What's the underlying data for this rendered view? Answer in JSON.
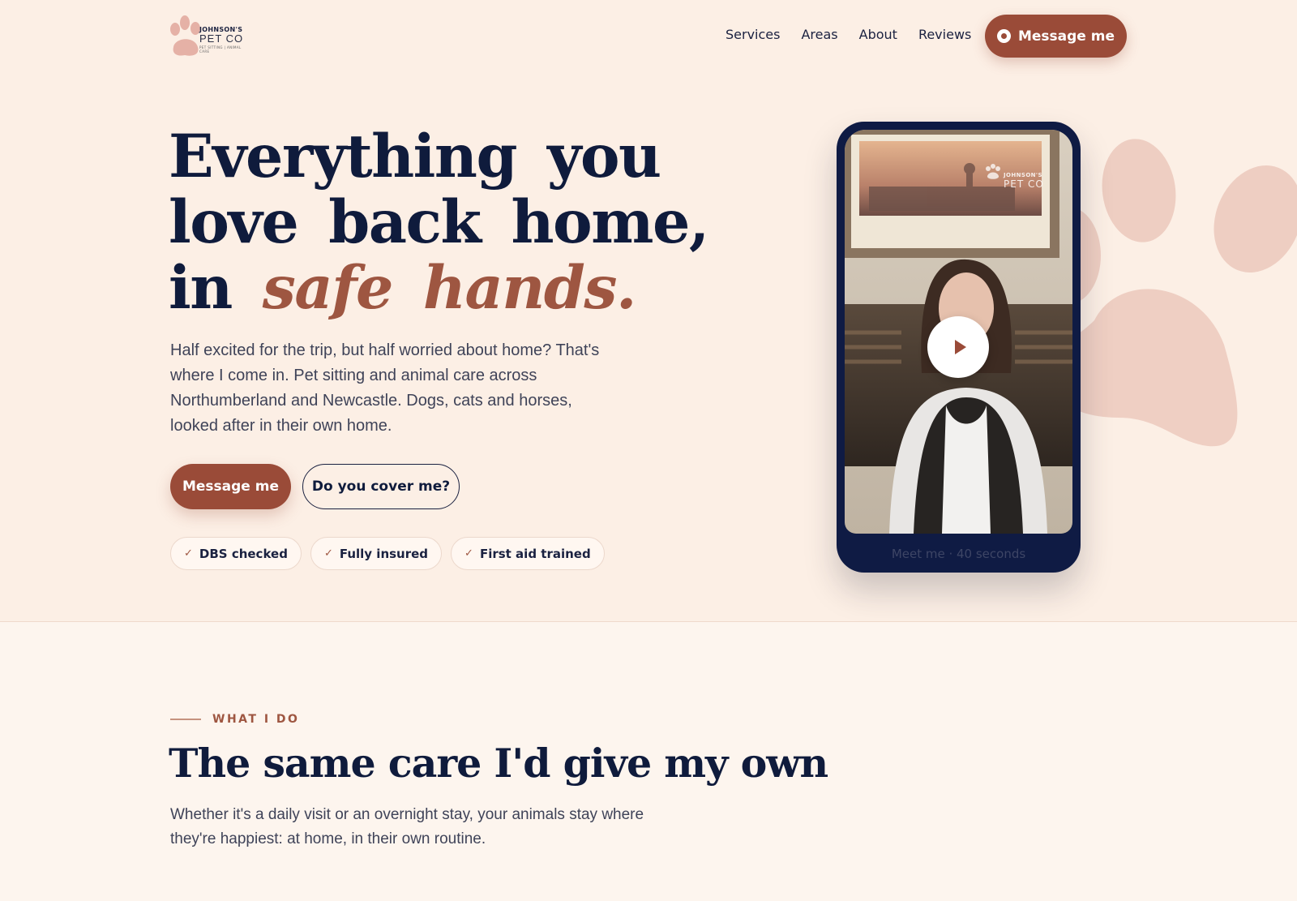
{
  "brand": {
    "logo_line1": "JOHNSON'S",
    "logo_line2": "PET CO",
    "logo_line3": "PET SITTING | ANIMAL CARE"
  },
  "nav": {
    "items": [
      "Services",
      "Areas",
      "About",
      "Reviews"
    ],
    "cta_label": "Message me"
  },
  "hero": {
    "headline_line1": "Everything you",
    "headline_line2": "love back home,",
    "headline_line3_prefix": "in",
    "headline_accent": "safe hands.",
    "lead": "Half excited for the trip, but half worried about home? That's where I come in. Pet sitting and animal care across Northumberland and Newcastle. Dogs, cats and horses, looked after in their own home.",
    "primary_button": "Message me",
    "secondary_button": "Do you cover me?",
    "badges": [
      "DBS checked",
      "Fully insured",
      "First aid trained"
    ]
  },
  "video": {
    "caption": "Meet me · 40 seconds",
    "watermark_line1": "JOHNSON'S",
    "watermark_line2": "PET CO"
  },
  "services": {
    "eyebrow": "WHAT I DO",
    "title": "The same care I'd give my own",
    "subtitle": "Whether it's a daily visit or an overnight stay, your animals stay where they're happiest: at home, in their own routine."
  },
  "colors": {
    "background": "#fcefe5",
    "navy": "#0f1b3c",
    "accent": "#9a4b38",
    "paw": "#ecc9bd"
  },
  "icons": [
    "paw-logo-icon",
    "whatsapp-icon",
    "check-icon",
    "play-icon"
  ]
}
